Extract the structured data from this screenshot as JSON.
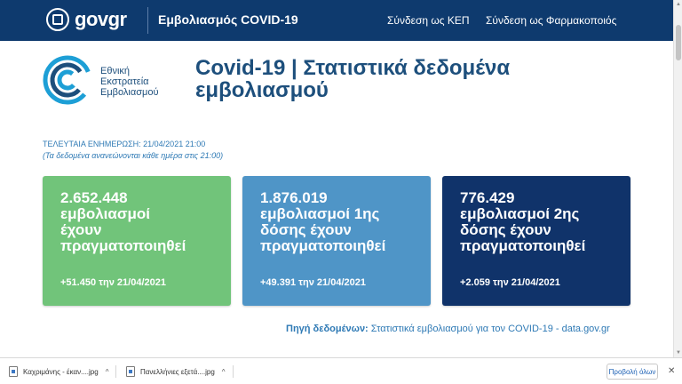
{
  "header": {
    "brand": "govgr",
    "app_title": "Εμβολιασμός COVID-19",
    "link_kep": "Σύνδεση ως ΚΕΠ",
    "link_pharmacist": "Σύνδεση ως Φαρμακοποιός"
  },
  "hero": {
    "org_name_line1": "Εθνική",
    "org_name_line2": "Εκστρατεία",
    "org_name_line3": "Εμβολιασμού",
    "title": "Covid-19 | Στατιστικά δεδομένα εμβολιασμού"
  },
  "update": {
    "last_updated": "ΤΕΛΕΥΤΑΙΑ ΕΝΗΜΕΡΩΣΗ: 21/04/2021 21:00",
    "note": "(Τα δεδομένα ανανεώνονται κάθε ημέρα στις 21:00)"
  },
  "cards": [
    {
      "value": "2.652.448",
      "label_line1": "εμβολιασμοί",
      "label_line2": "έχουν",
      "label_line3": "πραγματοποιηθεί",
      "delta": "+51.450 την 21/04/2021",
      "color": "#71c47a"
    },
    {
      "value": "1.876.019",
      "label_line1": "εμβολιασμοί 1ης",
      "label_line2": "δόσης έχουν",
      "label_line3": "πραγματοποιηθεί",
      "delta": "+49.391 την 21/04/2021",
      "color": "#4f95c7"
    },
    {
      "value": "776.429",
      "label_line1": "εμβολιασμοί 2ης",
      "label_line2": "δόσης έχουν",
      "label_line3": "πραγματοποιηθεί",
      "delta": "+2.059 την 21/04/2021",
      "color": "#10336a"
    }
  ],
  "source": {
    "label": "Πηγή δεδομένων:",
    "text": "Στατιστικά εμβολιασμού για τον COVID-19 - data.gov.gr"
  },
  "downloads": {
    "items": [
      {
        "name": "Καχριμάνης - έκαν....jpg",
        "icon": "image-file-icon"
      },
      {
        "name": "Πανελλήνιες εξετά....jpg",
        "icon": "image-file-icon"
      }
    ],
    "show_all": "Προβολή όλων"
  },
  "colors": {
    "header_bg": "#0e3a6e",
    "title_blue": "#1d4f7c",
    "accent_blue": "#2f7ab5"
  }
}
